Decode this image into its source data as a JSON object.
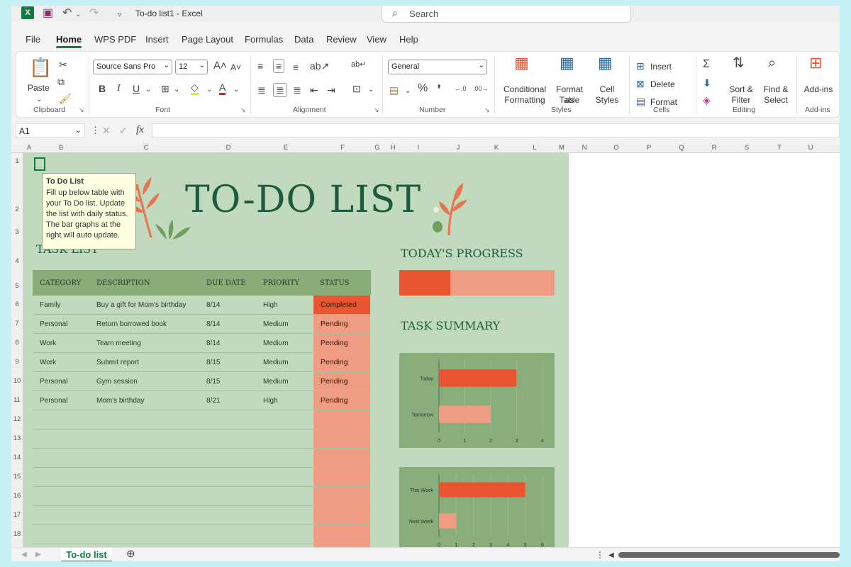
{
  "titlebar": {
    "title": "To-do list1  -  Excel",
    "search_placeholder": "Search"
  },
  "menu": [
    "File",
    "Home",
    "WPS PDF",
    "Insert",
    "Page Layout",
    "Formulas",
    "Data",
    "Review",
    "View",
    "Help"
  ],
  "ribbon": {
    "clipboard": {
      "paste": "Paste",
      "label": "Clipboard"
    },
    "font": {
      "name": "Source Sans Pro",
      "size": "12",
      "bold": "B",
      "italic": "I",
      "underline": "U",
      "label": "Font"
    },
    "alignment": {
      "label": "Alignment"
    },
    "number": {
      "format": "General",
      "label": "Number"
    },
    "styles": {
      "conditional": "Conditional",
      "conditional2": "Formatting",
      "format_as": "Format as",
      "format_as2": "Table",
      "cell": "Cell",
      "cell2": "Styles",
      "label": "Styles"
    },
    "cells": {
      "insert": "Insert",
      "delete": "Delete",
      "format": "Format",
      "label": "Cells"
    },
    "editing": {
      "sort": "Sort &",
      "sort2": "Filter",
      "find": "Find &",
      "find2": "Select",
      "label": "Editing"
    },
    "addins": {
      "addins": "Add-ins",
      "label": "Add-ins"
    }
  },
  "formula": {
    "cell_ref": "A1",
    "fx": "fx"
  },
  "columns": [
    "A",
    "B",
    "C",
    "D",
    "E",
    "F",
    "G",
    "H",
    "I",
    "J",
    "K",
    "L",
    "M",
    "N",
    "O",
    "P",
    "Q",
    "R",
    "S",
    "T",
    "U"
  ],
  "rows": [
    "1",
    "2",
    "3",
    "4",
    "5",
    "6",
    "7",
    "8",
    "9",
    "10",
    "11",
    "12",
    "13",
    "14",
    "15",
    "16",
    "17",
    "18"
  ],
  "sheet": {
    "title": "TO-DO LIST",
    "task_list_title": "TASK LIST",
    "progress_title": "TODAY'S PROGRESS",
    "summary_title": "TASK SUMMARY",
    "progress_fraction": 0.33,
    "headers": [
      "CATEGORY",
      "DESCRIPTION",
      "DUE DATE",
      "PRIORITY",
      "STATUS"
    ],
    "tasks": [
      {
        "category": "Family",
        "description": "Buy a gift for Mom's birthday",
        "due": "8/14",
        "priority": "High",
        "status": "Completed"
      },
      {
        "category": "Personal",
        "description": "Return borrowed book",
        "due": "8/14",
        "priority": "Medium",
        "status": "Pending"
      },
      {
        "category": "Work",
        "description": "Team meeting",
        "due": "8/14",
        "priority": "Medium",
        "status": "Pending"
      },
      {
        "category": "Work",
        "description": "Submit report",
        "due": "8/15",
        "priority": "Medium",
        "status": "Pending"
      },
      {
        "category": "Personal",
        "description": "Gym session",
        "due": "8/15",
        "priority": "Medium",
        "status": "Pending"
      },
      {
        "category": "Personal",
        "description": "Mom's birthday",
        "due": "8/21",
        "priority": "High",
        "status": "Pending"
      }
    ]
  },
  "tooltip": {
    "title": "To Do List",
    "body": "Fill up below table with your To Do list. Update the list with daily status. The bar graphs at the right will auto update."
  },
  "sheet_tab": "To-do list",
  "colors": {
    "excel_green": "#107c41",
    "sheet_bg": "#c1d9bc",
    "accent_dark": "#e85530",
    "accent_light": "#f09c82",
    "header_green": "#88ad79",
    "title_green": "#1d5a3e"
  },
  "chart_data": [
    {
      "type": "bar",
      "orientation": "horizontal",
      "categories": [
        "Today",
        "Tomorrow"
      ],
      "values": [
        3,
        2
      ],
      "xlim": [
        0,
        4
      ],
      "xticks": [
        0,
        1,
        2,
        3,
        4
      ],
      "colors": [
        "#e85530",
        "#f09c82"
      ]
    },
    {
      "type": "bar",
      "orientation": "horizontal",
      "categories": [
        "This Week",
        "Next Week"
      ],
      "values": [
        5,
        1
      ],
      "xlim": [
        0,
        6
      ],
      "xticks": [
        0,
        1,
        2,
        3,
        4,
        5,
        6
      ],
      "colors": [
        "#e85530",
        "#f09c82"
      ]
    }
  ]
}
